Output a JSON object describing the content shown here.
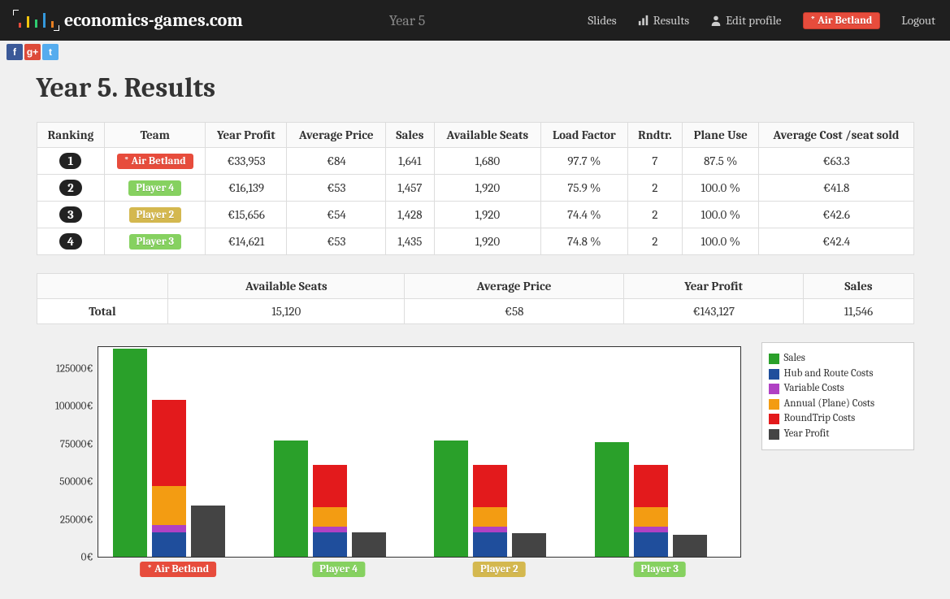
{
  "brand": "economics-games.com",
  "nav": {
    "year": "Year 5",
    "slides": "Slides",
    "results": "Results",
    "edit_profile": "Edit profile",
    "current_player": "* Air Betland",
    "logout": "Logout"
  },
  "page_title": "Year 5. Results",
  "table": {
    "headers": {
      "ranking": "Ranking",
      "team": "Team",
      "year_profit": "Year Profit",
      "avg_price": "Average Price",
      "sales": "Sales",
      "avail_seats": "Available Seats",
      "load_factor": "Load Factor",
      "rndtr": "Rndtr.",
      "plane_use": "Plane Use",
      "avg_cost_seat": "Average Cost /seat sold"
    },
    "rows": [
      {
        "rank": "1",
        "team": "* Air Betland",
        "team_color": "#e74c3c",
        "year_profit": "€33,953",
        "avg_price": "€84",
        "sales": "1,641",
        "avail_seats": "1,680",
        "load_factor": "97.7 %",
        "rndtr": "7",
        "plane_use": "87.5 %",
        "avg_cost_seat": "€63.3"
      },
      {
        "rank": "2",
        "team": "Player 4",
        "team_color": "#86d160",
        "year_profit": "€16,139",
        "avg_price": "€53",
        "sales": "1,457",
        "avail_seats": "1,920",
        "load_factor": "75.9 %",
        "rndtr": "2",
        "plane_use": "100.0 %",
        "avg_cost_seat": "€41.8"
      },
      {
        "rank": "3",
        "team": "Player 2",
        "team_color": "#d4b84f",
        "year_profit": "€15,656",
        "avg_price": "€54",
        "sales": "1,428",
        "avail_seats": "1,920",
        "load_factor": "74.4 %",
        "rndtr": "2",
        "plane_use": "100.0 %",
        "avg_cost_seat": "€42.6"
      },
      {
        "rank": "4",
        "team": "Player 3",
        "team_color": "#86d160",
        "year_profit": "€14,621",
        "avg_price": "€53",
        "sales": "1,435",
        "avail_seats": "1,920",
        "load_factor": "74.8 %",
        "rndtr": "2",
        "plane_use": "100.0 %",
        "avg_cost_seat": "€42.4"
      }
    ]
  },
  "totals": {
    "label": "Total",
    "headers": {
      "avail_seats": "Available Seats",
      "avg_price": "Average Price",
      "year_profit": "Year Profit",
      "sales": "Sales"
    },
    "values": {
      "avail_seats": "15,120",
      "avg_price": "€58",
      "year_profit": "€143,127",
      "sales": "11,546"
    }
  },
  "chart_data": {
    "type": "bar",
    "ylabel": "",
    "xlabel": "",
    "title": "",
    "ylim": [
      0,
      140000
    ],
    "yticks": [
      0,
      25000,
      50000,
      75000,
      100000,
      125000
    ],
    "ytick_labels": [
      "0€",
      "25000€",
      "50000€",
      "75000€",
      "100000€",
      "125000€"
    ],
    "categories": [
      "* Air Betland",
      "Player 4",
      "Player 2",
      "Player 3"
    ],
    "category_colors": [
      "#e74c3c",
      "#86d160",
      "#d4b84f",
      "#86d160"
    ],
    "series": [
      {
        "name": "Sales",
        "color": "#2aa02a",
        "values": [
          138000,
          77000,
          77000,
          76000
        ],
        "group": "a"
      },
      {
        "name": "Hub and Route Costs",
        "color": "#1f4e9c",
        "values": [
          16000,
          16000,
          16000,
          16000
        ],
        "group": "b"
      },
      {
        "name": "Variable Costs",
        "color": "#b041c4",
        "values": [
          5000,
          4000,
          4000,
          4000
        ],
        "group": "b"
      },
      {
        "name": "Annual (Plane) Costs",
        "color": "#f39c12",
        "values": [
          26000,
          13000,
          13000,
          13000
        ],
        "group": "b"
      },
      {
        "name": "RoundTrip Costs",
        "color": "#e31a1c",
        "values": [
          57000,
          28000,
          28000,
          28000
        ],
        "group": "b"
      },
      {
        "name": "Year Profit",
        "color": "#444444",
        "values": [
          33953,
          16139,
          15656,
          14621
        ],
        "group": "c"
      }
    ],
    "legend_position": "right"
  }
}
